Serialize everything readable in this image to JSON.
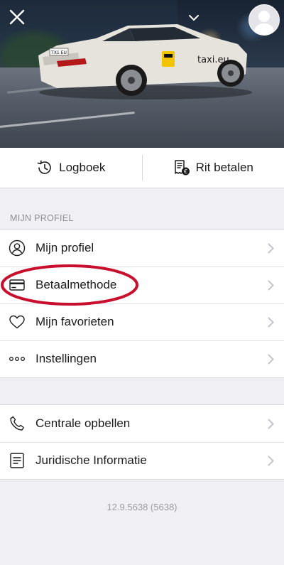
{
  "header": {
    "close_icon": "close-icon",
    "menu_icon": "chevron-down-icon",
    "avatar_icon": "user-avatar-icon",
    "hero_image": "taxi-car-image",
    "car_brand_text": "taxi.eu",
    "car_plate": "TX1 EU"
  },
  "actions": {
    "logbook_label": "Logboek",
    "logbook_icon": "history-icon",
    "pay_label": "Rit betalen",
    "pay_icon": "receipt-euro-icon"
  },
  "profile_section": {
    "title": "MIJN PROFIEL",
    "items": [
      {
        "label": "Mijn profiel",
        "icon": "user-icon"
      },
      {
        "label": "Betaalmethode",
        "icon": "credit-card-icon"
      },
      {
        "label": "Mijn favorieten",
        "icon": "heart-icon"
      },
      {
        "label": "Instellingen",
        "icon": "more-dots-icon"
      }
    ]
  },
  "support_section": {
    "items": [
      {
        "label": "Centrale opbellen",
        "icon": "phone-icon"
      },
      {
        "label": "Juridische Informatie",
        "icon": "document-icon"
      }
    ]
  },
  "version": "12.9.5638 (5638)",
  "colors": {
    "background": "#efeff4",
    "highlight": "#c8102e",
    "chevron": "#c4c4c9"
  }
}
